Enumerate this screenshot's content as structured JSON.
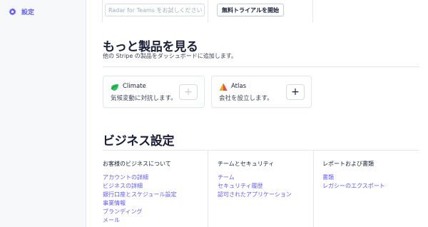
{
  "sidebar": {
    "settings_label": "設定",
    "accent": "#635bff"
  },
  "top": {
    "trial_placeholder": "Radar for Teams をお試しください",
    "trial_button": "無料トライアルを開始"
  },
  "more_products": {
    "title": "もっと製品を見る",
    "subtitle": "他の Stripe の製品をダッシュボードに追加します。",
    "cards": [
      {
        "name": "Climate",
        "description": "気候変動に対抗します。",
        "icon": "climate-leaf-icon",
        "add_glyph": "+"
      },
      {
        "name": "Atlas",
        "description": "会社を設立します。",
        "icon": "atlas-triangle-icon",
        "add_glyph": "+"
      }
    ]
  },
  "business_settings": {
    "title": "ビジネス設定",
    "columns": [
      {
        "title": "お客様のビジネスについて",
        "links": [
          "アカウントの詳細",
          "ビジネスの詳細",
          "銀行口座とスケジュール設定",
          "事業情報",
          "ブランディング",
          "メール"
        ]
      },
      {
        "title": "チームとセキュリティ",
        "links": [
          "チーム",
          "セキュリティ履歴",
          "認可されたアプリケーション"
        ]
      },
      {
        "title": "レポートおよび書類",
        "links": [
          "書類",
          "レガシーのエクスポート"
        ]
      }
    ]
  }
}
